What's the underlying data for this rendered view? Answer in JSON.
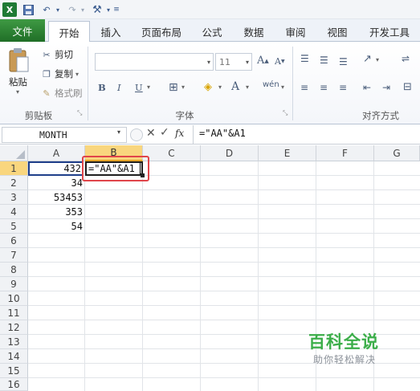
{
  "qat": {
    "icons": [
      "excel-logo-icon",
      "save-icon",
      "undo-icon",
      "redo-icon",
      "customize-tools-icon"
    ]
  },
  "tabs": [
    "文件",
    "开始",
    "插入",
    "页面布局",
    "公式",
    "数据",
    "审阅",
    "视图",
    "开发工具"
  ],
  "ribbon": {
    "clipboard": {
      "paste": "粘贴",
      "cut": "剪切",
      "copy": "复制",
      "format_painter": "格式刷",
      "group_label": "剪贴板"
    },
    "font": {
      "size": "11",
      "group_label": "字体"
    },
    "align": {
      "group_label": "对齐方式"
    }
  },
  "formula_bar": {
    "name_box": "MONTH",
    "fx": "fx",
    "formula": "=\"AA\"&A1"
  },
  "columns": [
    "A",
    "B",
    "C",
    "D",
    "E",
    "F",
    "G"
  ],
  "rows": [
    "1",
    "2",
    "3",
    "4",
    "5",
    "6",
    "7",
    "8",
    "9",
    "10",
    "11",
    "12",
    "13",
    "14",
    "15",
    "16"
  ],
  "cells": {
    "a1": "432",
    "a2": "34",
    "a3": "53453",
    "a4": "353",
    "a5": "54",
    "b1": "=\"AA\"&A1"
  },
  "watermark": {
    "title": "百科全说",
    "subtitle": "助你轻松解决"
  },
  "colors": {
    "file_tab": "#2e7d32",
    "highlight": "#e0454a",
    "selected_header": "#f9d67e"
  }
}
